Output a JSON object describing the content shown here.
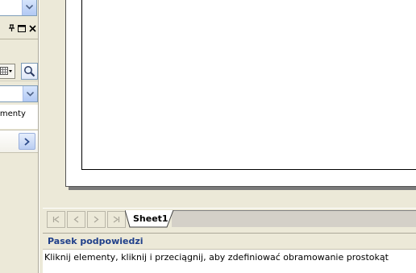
{
  "task_pane": {
    "list_item_text": "kumenty"
  },
  "sheet_tabs": [
    {
      "label": "Sheet1"
    }
  ],
  "hint_panel": {
    "title": "Pasek podpowiedzi",
    "text": "Kliknij elementy, kliknij i przeciągnij, aby zdefiniować obramowanie prostokąt"
  },
  "colors": {
    "hint_title": "#1f3f8a",
    "chrome": "#ece9d8",
    "button_blue": "#b9cdf2"
  }
}
